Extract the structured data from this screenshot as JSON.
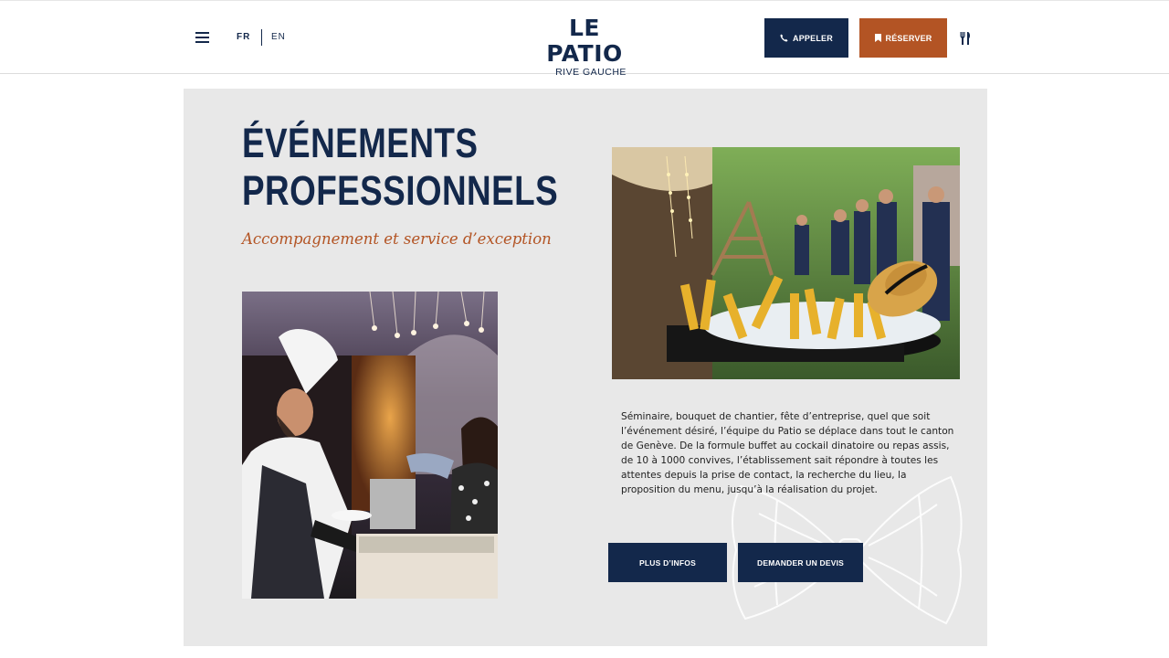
{
  "header": {
    "lang_fr": "FR",
    "lang_en": "EN",
    "logo_title": "LE PATIO",
    "logo_subtitle": "RIVE GAUCHE",
    "call_label": "APPELER",
    "book_label": "RÉSERVER",
    "icons": {
      "menu": "hamburger-menu-icon",
      "call": "phone-icon",
      "book": "bookmark-icon",
      "restaurant": "cutlery-icon"
    }
  },
  "main": {
    "title_line1": "ÉVÉNEMENTS",
    "title_line2": "PROFESSIONNELS",
    "subtitle": "Accompagnement et service d’exception",
    "description": "Séminaire, bouquet de chantier, fête d’entreprise, quel que soit l’événement désiré, l’équipe du Patio se déplace dans tout le canton de Genève. De la formule buffet au cockail dinatoire ou repas assis, de 10 à 1000 convives, l’établissement sait répondre à toutes les attentes depuis la prise de contact, la recherche du lieu, la proposition du menu, jusqu’à la réalisation du projet.",
    "more_info_label": "PLUS D’INFOS",
    "quote_label": "DEMANDER UN DEVIS"
  },
  "colors": {
    "navy": "#13284b",
    "rust": "#b35424",
    "section_bg": "#e8e8e8"
  }
}
